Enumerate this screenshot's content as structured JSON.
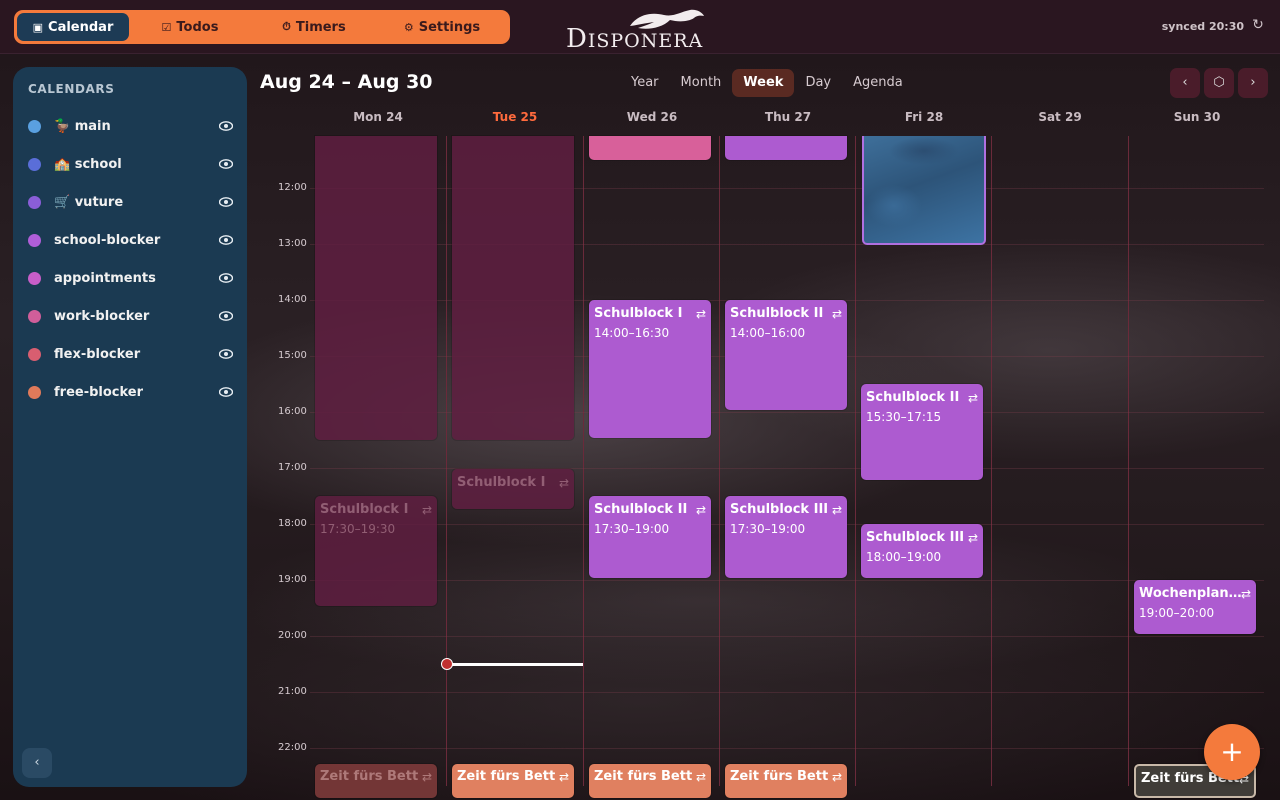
{
  "nav": {
    "tabs": [
      {
        "label": "Calendar",
        "icon": "calendar-icon",
        "active": true
      },
      {
        "label": "Todos",
        "icon": "checkbox-icon",
        "active": false
      },
      {
        "label": "Timers",
        "icon": "stopwatch-icon",
        "active": false
      },
      {
        "label": "Settings",
        "icon": "gear-icon",
        "active": false
      }
    ],
    "logo_text": "Disponera",
    "sync_status": "synced 20:30"
  },
  "sidebar": {
    "title": "CALENDARS",
    "calendars": [
      {
        "name": "🦆 main",
        "color": "#5aa0e0"
      },
      {
        "name": "🏫 school",
        "color": "#5a6ed8"
      },
      {
        "name": "🛒 vuture",
        "color": "#8a5ed8"
      },
      {
        "name": "school-blocker",
        "color": "#b05ed8"
      },
      {
        "name": "appointments",
        "color": "#c85ec8"
      },
      {
        "name": "work-blocker",
        "color": "#d05e9a"
      },
      {
        "name": "flex-blocker",
        "color": "#d85e70"
      },
      {
        "name": "free-blocker",
        "color": "#e07a5a"
      }
    ]
  },
  "header": {
    "range": "Aug 24 – Aug 30",
    "views": [
      {
        "label": "Year",
        "active": false
      },
      {
        "label": "Month",
        "active": false
      },
      {
        "label": "Week",
        "active": true
      },
      {
        "label": "Day",
        "active": false
      },
      {
        "label": "Agenda",
        "active": false
      }
    ],
    "prev": "‹",
    "today": "⬡",
    "next": "›"
  },
  "days": [
    {
      "label": "Mon 24",
      "today": false
    },
    {
      "label": "Tue 25",
      "today": true
    },
    {
      "label": "Wed 26",
      "today": false
    },
    {
      "label": "Thu 27",
      "today": false
    },
    {
      "label": "Fri 28",
      "today": false
    },
    {
      "label": "Sat 29",
      "today": false
    },
    {
      "label": "Sun 30",
      "today": false
    }
  ],
  "hours": [
    "12:00",
    "13:00",
    "14:00",
    "15:00",
    "16:00",
    "17:00",
    "18:00",
    "19:00",
    "20:00",
    "21:00",
    "22:00"
  ],
  "events": [
    {
      "day": 2,
      "title": "Schulblock I",
      "time": "14:00–16:30"
    },
    {
      "day": 3,
      "title": "Schulblock II",
      "time": "14:00–16:00"
    },
    {
      "day": 4,
      "title": "Schulblock II",
      "time": "15:30–17:15"
    },
    {
      "day": 1,
      "title": "Schulblock I",
      "time": ""
    },
    {
      "day": 0,
      "title": "Schulblock I",
      "time": "17:30–19:30"
    },
    {
      "day": 2,
      "title": "Schulblock II",
      "time": "17:30–19:00"
    },
    {
      "day": 3,
      "title": "Schulblock III",
      "time": "17:30–19:00"
    },
    {
      "day": 4,
      "title": "Schulblock III",
      "time": "18:00–19:00"
    },
    {
      "day": 6,
      "title": "Wochenplan…",
      "time": "19:00–20:00"
    },
    {
      "day": 0,
      "title": "Zeit fürs Bett",
      "time": ""
    },
    {
      "day": 1,
      "title": "Zeit fürs Bett",
      "time": ""
    },
    {
      "day": 2,
      "title": "Zeit fürs Bett",
      "time": ""
    },
    {
      "day": 3,
      "title": "Zeit fürs Bett",
      "time": ""
    },
    {
      "day": 6,
      "title": "Zeit fürs Bett",
      "time": ""
    }
  ],
  "fab_label": "+"
}
